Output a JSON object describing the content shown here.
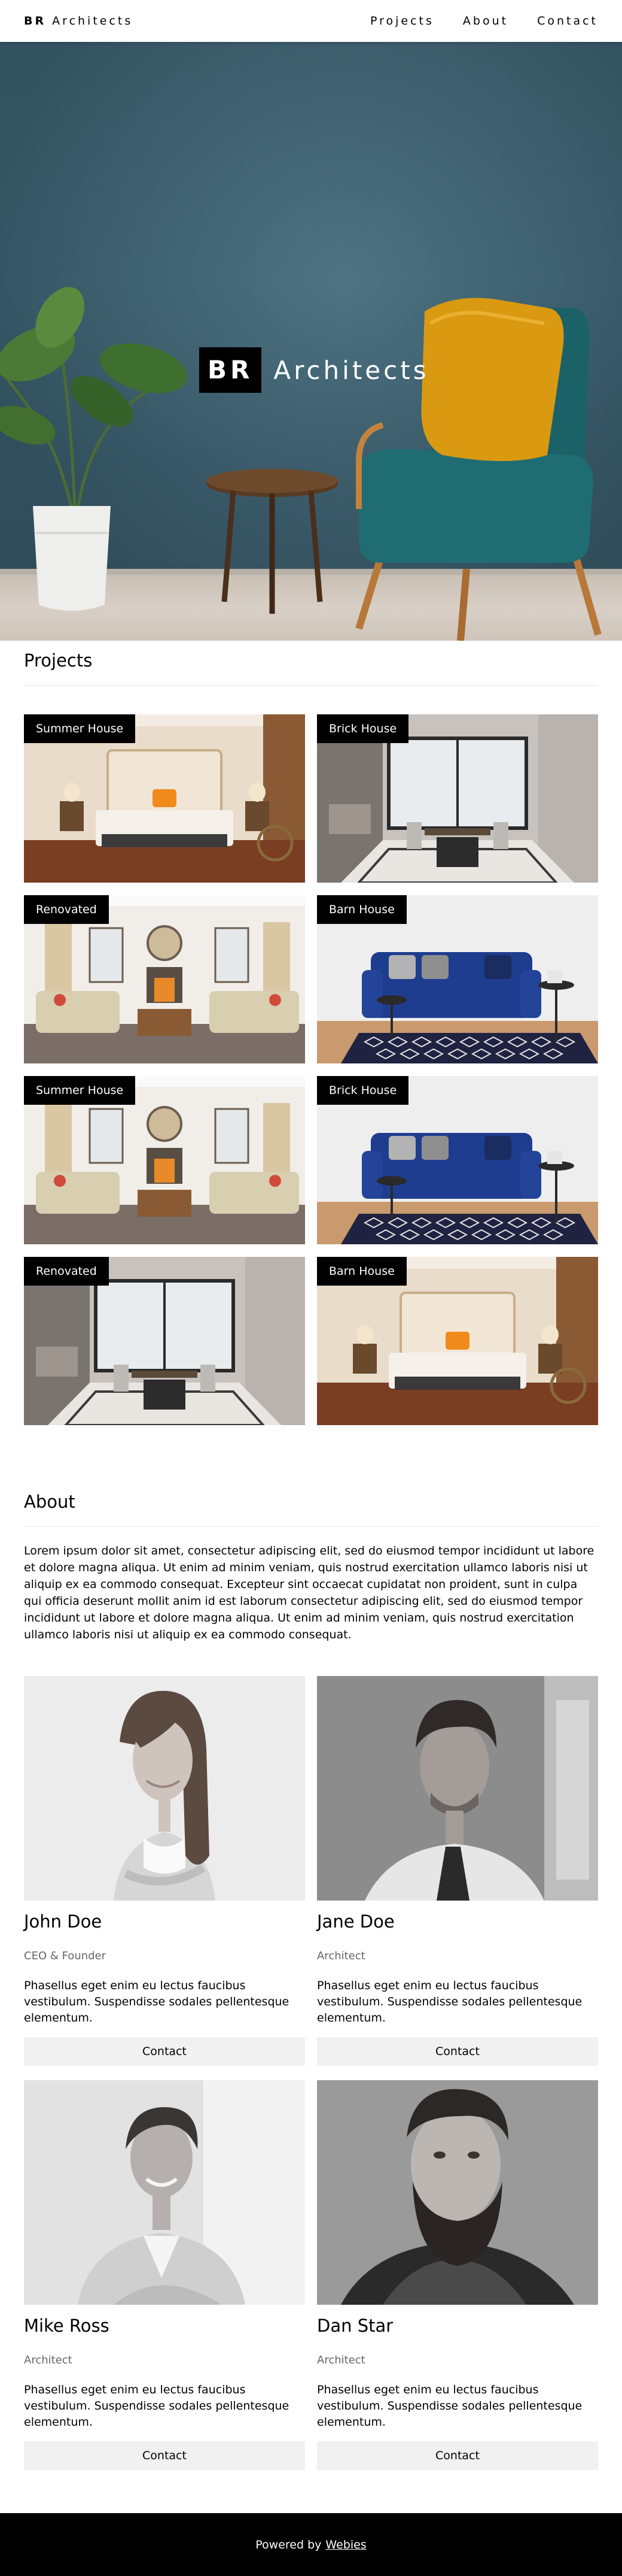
{
  "brand": {
    "bold": "BR",
    "rest": "Architects"
  },
  "nav": {
    "projects": "Projects",
    "about": "About",
    "contact": "Contact"
  },
  "hero": {
    "tag": "BR",
    "rest": "Architects"
  },
  "projects": {
    "title": "Projects",
    "items": [
      {
        "label": "Summer House",
        "scene": "bedroom"
      },
      {
        "label": "Brick House",
        "scene": "dining"
      },
      {
        "label": "Renovated",
        "scene": "living"
      },
      {
        "label": "Barn House",
        "scene": "sofa"
      },
      {
        "label": "Summer House",
        "scene": "living"
      },
      {
        "label": "Brick House",
        "scene": "sofa"
      },
      {
        "label": "Renovated",
        "scene": "dining"
      },
      {
        "label": "Barn House",
        "scene": "bedroom"
      }
    ]
  },
  "about": {
    "title": "About",
    "text": "Lorem ipsum dolor sit amet, consectetur adipiscing elit, sed do eiusmod tempor incididunt ut labore et dolore magna aliqua. Ut enim ad minim veniam, quis nostrud exercitation ullamco laboris nisi ut aliquip ex ea commodo consequat. Excepteur sint occaecat cupidatat non proident, sunt in culpa qui officia deserunt mollit anim id est laborum consectetur adipiscing elit, sed do eiusmod tempor incididunt ut labore et dolore magna aliqua. Ut enim ad minim veniam, quis nostrud exercitation ullamco laboris nisi ut aliquip ex ea commodo consequat."
  },
  "team": [
    {
      "name": "John Doe",
      "role": "CEO & Founder",
      "desc": "Phasellus eget enim eu lectus faucibus vestibulum. Suspendisse sodales pellentesque elementum.",
      "button": "Contact"
    },
    {
      "name": "Jane Doe",
      "role": "Architect",
      "desc": "Phasellus eget enim eu lectus faucibus vestibulum. Suspendisse sodales pellentesque elementum.",
      "button": "Contact"
    },
    {
      "name": "Mike Ross",
      "role": "Architect",
      "desc": "Phasellus eget enim eu lectus faucibus vestibulum. Suspendisse sodales pellentesque elementum.",
      "button": "Contact"
    },
    {
      "name": "Dan Star",
      "role": "Architect",
      "desc": "Phasellus eget enim eu lectus faucibus vestibulum. Suspendisse sodales pellentesque elementum.",
      "button": "Contact"
    }
  ],
  "footer": {
    "text": "Powered by",
    "link": "Webies"
  },
  "colors": {
    "wall": "#3f6778",
    "chair": "#1f6b70",
    "cushion": "#d99a12",
    "footer": "#000000",
    "button": "#f1f1f1"
  }
}
